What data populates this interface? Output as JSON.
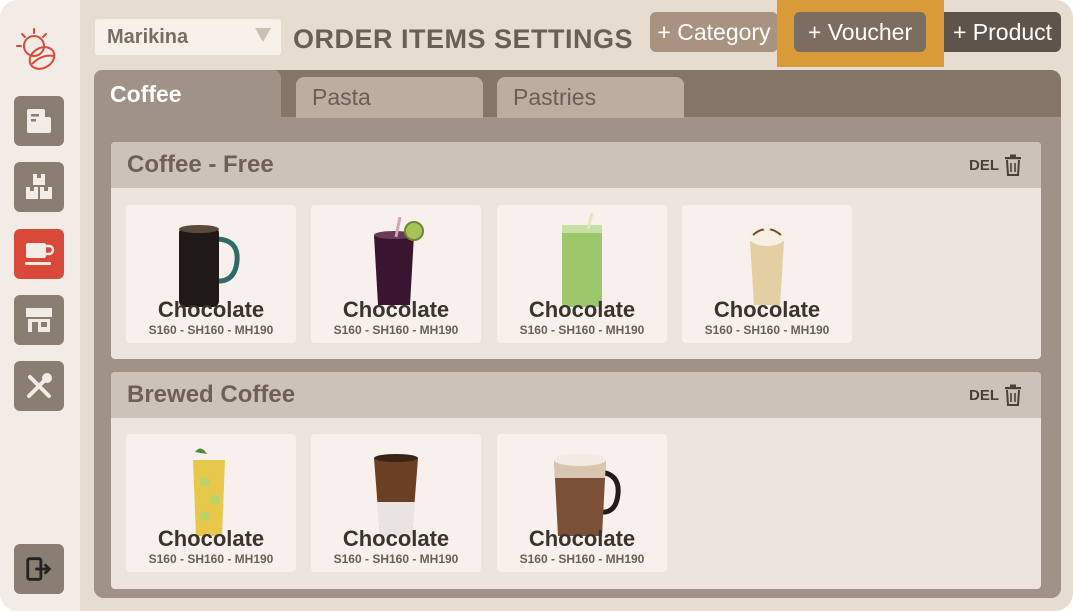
{
  "sidebar": {
    "logo": "sunflower-logo-icon",
    "items": [
      {
        "name": "orders",
        "icon": "receipt-icon",
        "active": false
      },
      {
        "name": "inventory",
        "icon": "boxes-icon",
        "active": false
      },
      {
        "name": "order-items",
        "icon": "coffee-cup-icon",
        "active": true
      },
      {
        "name": "store",
        "icon": "store-icon",
        "active": false
      },
      {
        "name": "settings",
        "icon": "tools-icon",
        "active": false
      }
    ],
    "logout_icon": "logout-icon"
  },
  "header": {
    "branch_select": {
      "value": "Marikina"
    },
    "title": "ORDER ITEMS SETTINGS",
    "buttons": {
      "category": "+ Category",
      "voucher": "+ Voucher",
      "product": "+ Product"
    }
  },
  "tabs": [
    {
      "label": "Coffee",
      "active": true
    },
    {
      "label": "Pasta",
      "active": false
    },
    {
      "label": "Pastries",
      "active": false
    }
  ],
  "sections": [
    {
      "title": "Coffee - Free",
      "del_label": "DEL",
      "items": [
        {
          "name": "Chocolate",
          "price": "S160 - SH160 - MH190",
          "image": "hot-dark-mug"
        },
        {
          "name": "Chocolate",
          "price": "S160 - SH160 - MH190",
          "image": "iced-berry-lime"
        },
        {
          "name": "Chocolate",
          "price": "S160 - SH160 - MH190",
          "image": "iced-matcha"
        },
        {
          "name": "Chocolate",
          "price": "S160 - SH160 - MH190",
          "image": "frappe-cream"
        }
      ]
    },
    {
      "title": "Brewed Coffee",
      "del_label": "DEL",
      "items": [
        {
          "name": "Chocolate",
          "price": "S160 - SH160 - MH190",
          "image": "lemon-iced-tea"
        },
        {
          "name": "Chocolate",
          "price": "S160 - SH160 - MH190",
          "image": "iced-latte"
        },
        {
          "name": "Chocolate",
          "price": "S160 - SH160 - MH190",
          "image": "hot-latte-mug"
        }
      ]
    }
  ],
  "colors": {
    "accent_active": "#d9493a",
    "highlight_frame": "#d99a3a",
    "panel": "#857468"
  }
}
